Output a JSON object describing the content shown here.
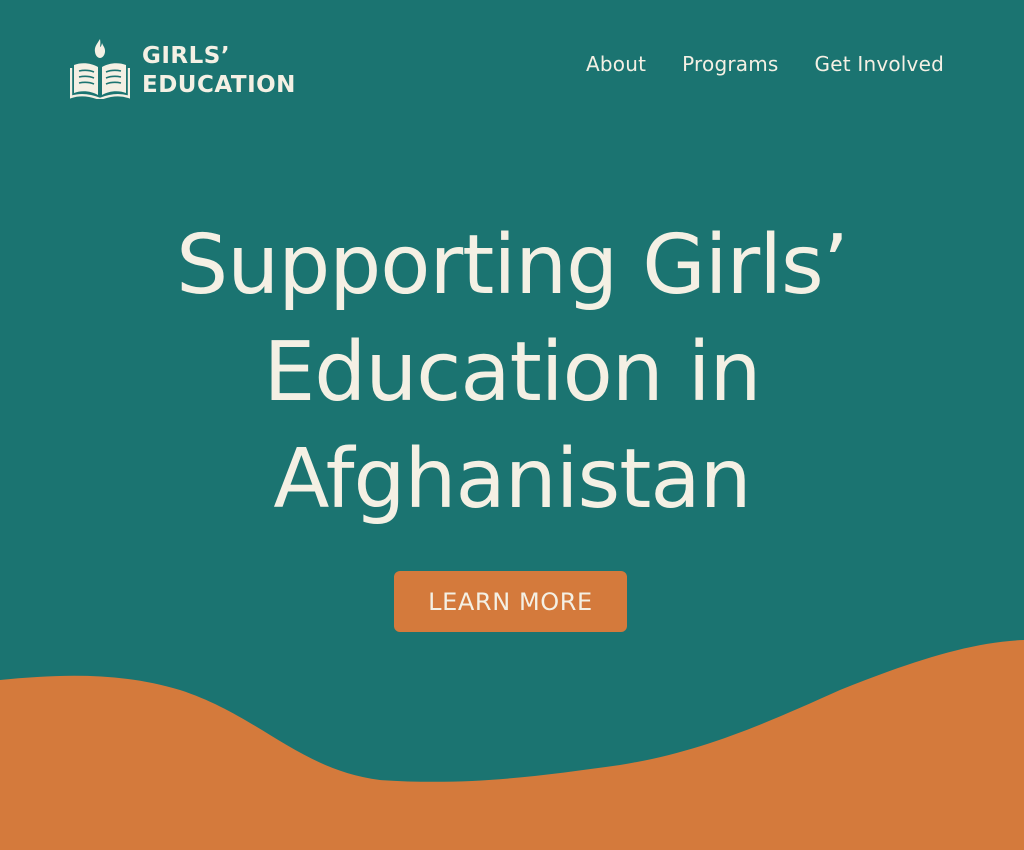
{
  "brand": {
    "line1": "GIRLS’",
    "line2": "EDUCATION",
    "icon": "book-with-flame-icon"
  },
  "nav": {
    "items": [
      {
        "label": "About"
      },
      {
        "label": "Programs"
      },
      {
        "label": "Get Involved"
      }
    ]
  },
  "hero": {
    "title_line1": "Supporting Girls’",
    "title_line2": "Education in",
    "title_line3": "Afghanistan",
    "cta_label": "LEARN MORE"
  },
  "colors": {
    "background": "#1b7471",
    "text": "#f4f0e4",
    "accent": "#d47a3c"
  }
}
